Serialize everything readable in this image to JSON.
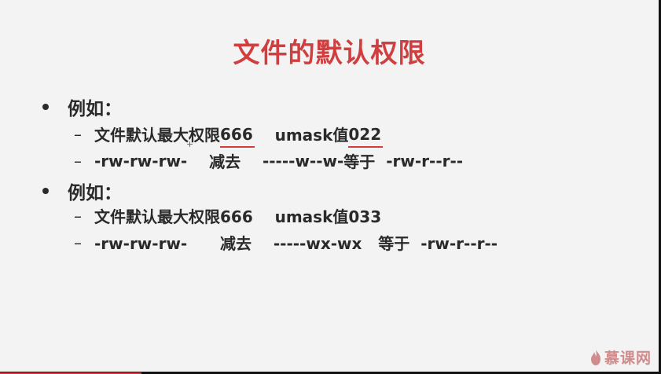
{
  "slide": {
    "title": "文件的默认权限",
    "blocks": [
      {
        "heading": "例如：",
        "lines": [
          [
            "文件默认最大权限",
            "666",
            "    umask值",
            "022",
            ""
          ],
          [
            "-rw-rw-rw-",
            "    减去    ",
            "-----w--w-",
            "等于  ",
            "-rw-r--r--"
          ]
        ]
      },
      {
        "heading": "例如：",
        "lines": [
          [
            "文件默认最大权限666    umask值033"
          ],
          [
            "-rw-rw-rw-      减去    -----wx-wx   等于  -rw-r--r--"
          ]
        ]
      }
    ]
  },
  "watermark": {
    "text": "慕课网",
    "icon": "flame-icon"
  },
  "colors": {
    "title": "#cf3f40",
    "text": "#2a2a2a",
    "background": "#f3f3f3",
    "underline": "#cf3f40"
  }
}
